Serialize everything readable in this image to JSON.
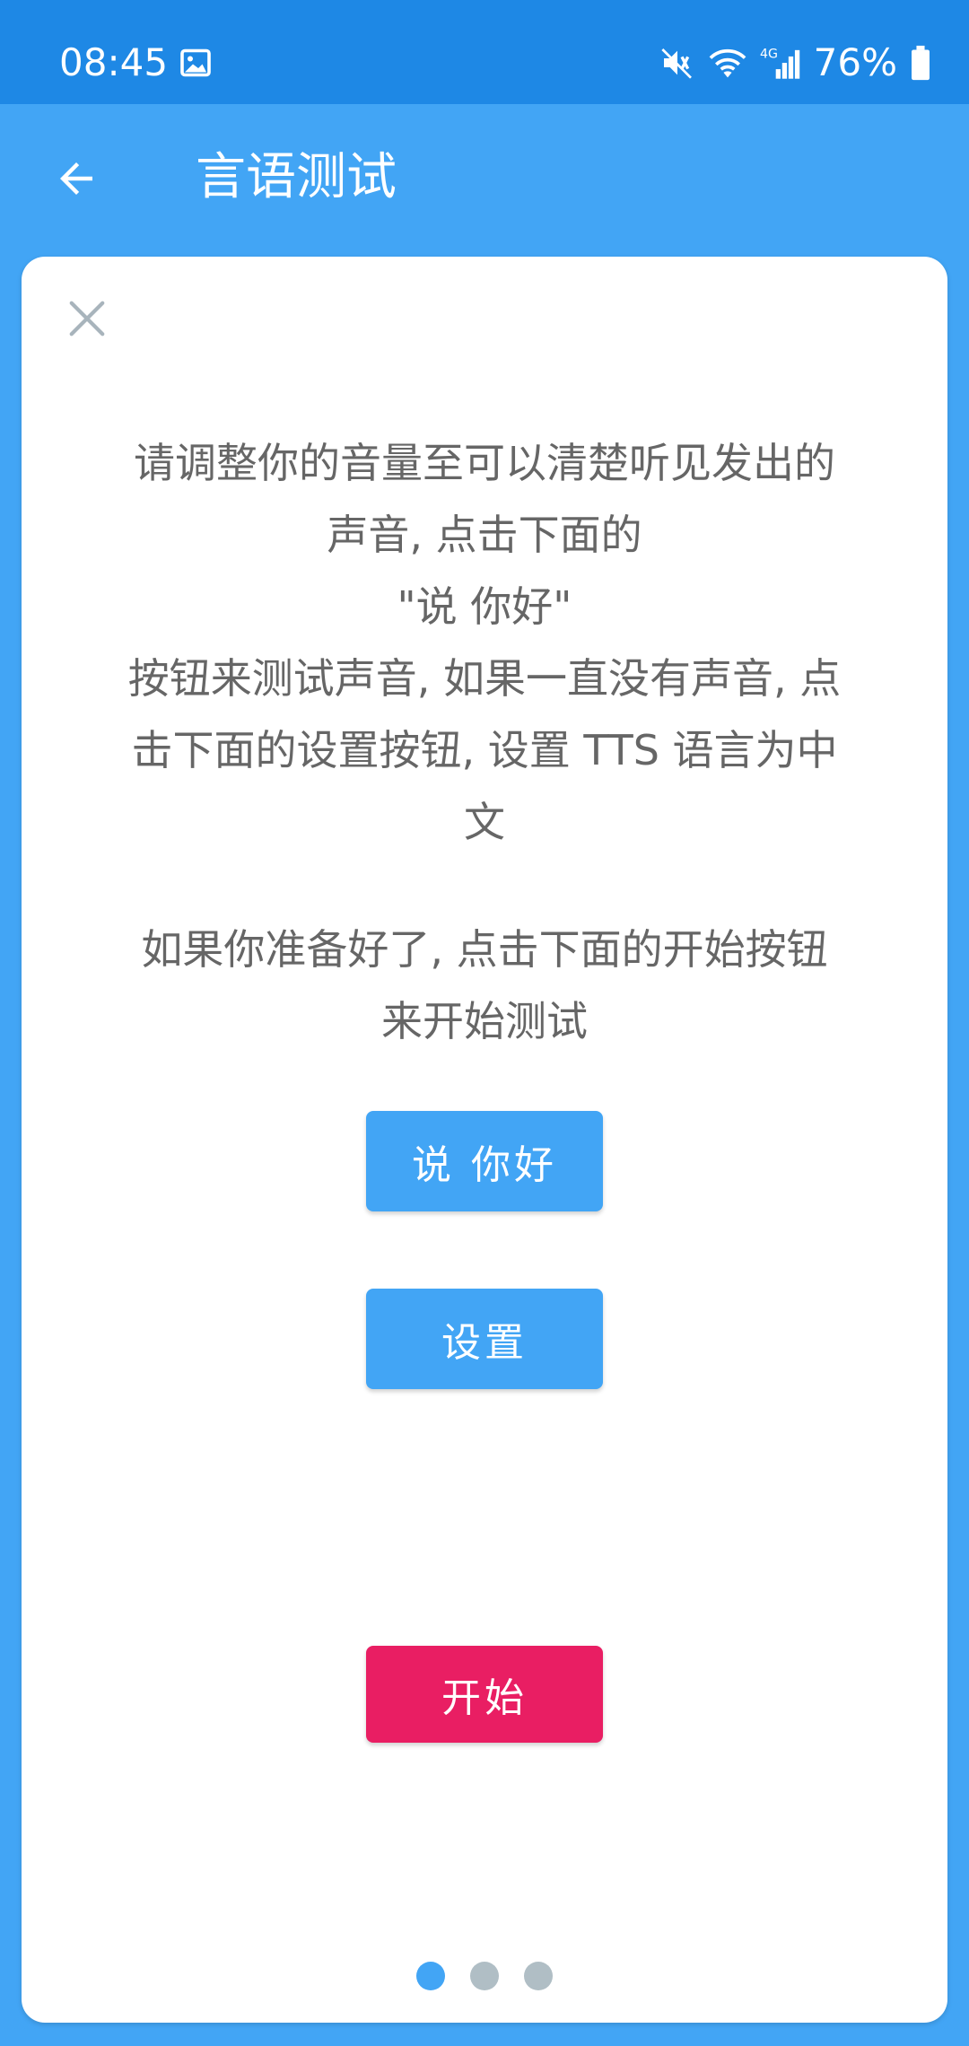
{
  "status_bar": {
    "time": "08:45",
    "battery": "76%",
    "icons": [
      "image-icon",
      "mute-icon",
      "wifi-icon",
      "signal-4g-icon",
      "battery-icon"
    ]
  },
  "app_bar": {
    "title": "言语测试",
    "back_icon": "arrow-left-icon"
  },
  "card": {
    "close_icon": "close-icon",
    "paragraph1": [
      "请调整你的音量至可以清楚听见发出的",
      "声音, 点击下面的",
      "\"说 你好\"",
      "按钮来测试声音, 如果一直没有声音, 点",
      "击下面的设置按钮, 设置 TTS 语言为中",
      "文"
    ],
    "paragraph2": [
      "如果你准备好了, 点击下面的开始按钮",
      "来开始测试"
    ],
    "say_hello_label": "说 你好",
    "settings_label": "设置",
    "start_label": "开始",
    "page_indicator": {
      "count": 3,
      "active": 0
    }
  },
  "colors": {
    "status_bar": "#1E88E5",
    "primary": "#42A5F5",
    "accent": "#E91E63",
    "text": "#666666",
    "dot_inactive": "#B0BEC5"
  }
}
